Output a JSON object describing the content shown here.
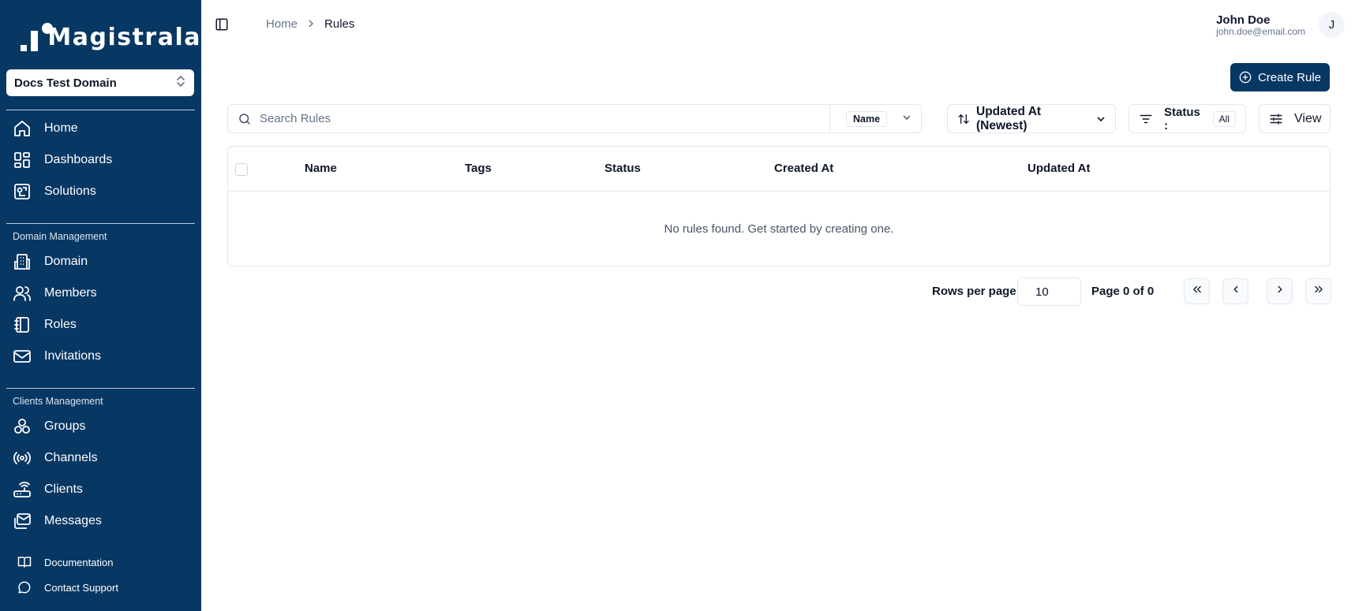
{
  "brand": {
    "name": "Magistrala"
  },
  "domain_selector": {
    "value": "Docs Test Domain"
  },
  "nav": {
    "primary": [
      {
        "label": "Home",
        "icon": "home-icon"
      },
      {
        "label": "Dashboards",
        "icon": "dashboard-icon"
      },
      {
        "label": "Solutions",
        "icon": "solutions-icon"
      }
    ],
    "domain_management_label": "Domain Management",
    "domain_management": [
      {
        "label": "Domain",
        "icon": "building-icon"
      },
      {
        "label": "Members",
        "icon": "users-icon"
      },
      {
        "label": "Roles",
        "icon": "notebook-icon"
      },
      {
        "label": "Invitations",
        "icon": "mail-icon"
      }
    ],
    "clients_management_label": "Clients Management",
    "clients_management": [
      {
        "label": "Groups",
        "icon": "groups-icon"
      },
      {
        "label": "Channels",
        "icon": "radio-icon"
      },
      {
        "label": "Clients",
        "icon": "router-icon"
      },
      {
        "label": "Messages",
        "icon": "messages-icon"
      }
    ],
    "footer": [
      {
        "label": "Documentation",
        "icon": "book-icon"
      },
      {
        "label": "Contact Support",
        "icon": "chat-icon"
      }
    ]
  },
  "breadcrumb": {
    "home": "Home",
    "current": "Rules"
  },
  "user": {
    "name": "John Doe",
    "email": "john.doe@email.com",
    "initial": "J"
  },
  "toolbar": {
    "create_label": "Create Rule",
    "search_placeholder": "Search Rules",
    "search_field": "Name",
    "sort_label": "Updated At (Newest)",
    "status_label": "Status :",
    "status_value": "All",
    "view_label": "View"
  },
  "table": {
    "columns": [
      "Name",
      "Tags",
      "Status",
      "Created At",
      "Updated At"
    ],
    "empty_message": "No rules found. Get started by creating one."
  },
  "pagination": {
    "rows_per_page_label": "Rows per page",
    "rows_per_page": "10",
    "page_label": "Page 0 of 0"
  },
  "colors": {
    "sidebar": "#073763",
    "primary_button": "#073763",
    "border": "#e2e8f0"
  }
}
